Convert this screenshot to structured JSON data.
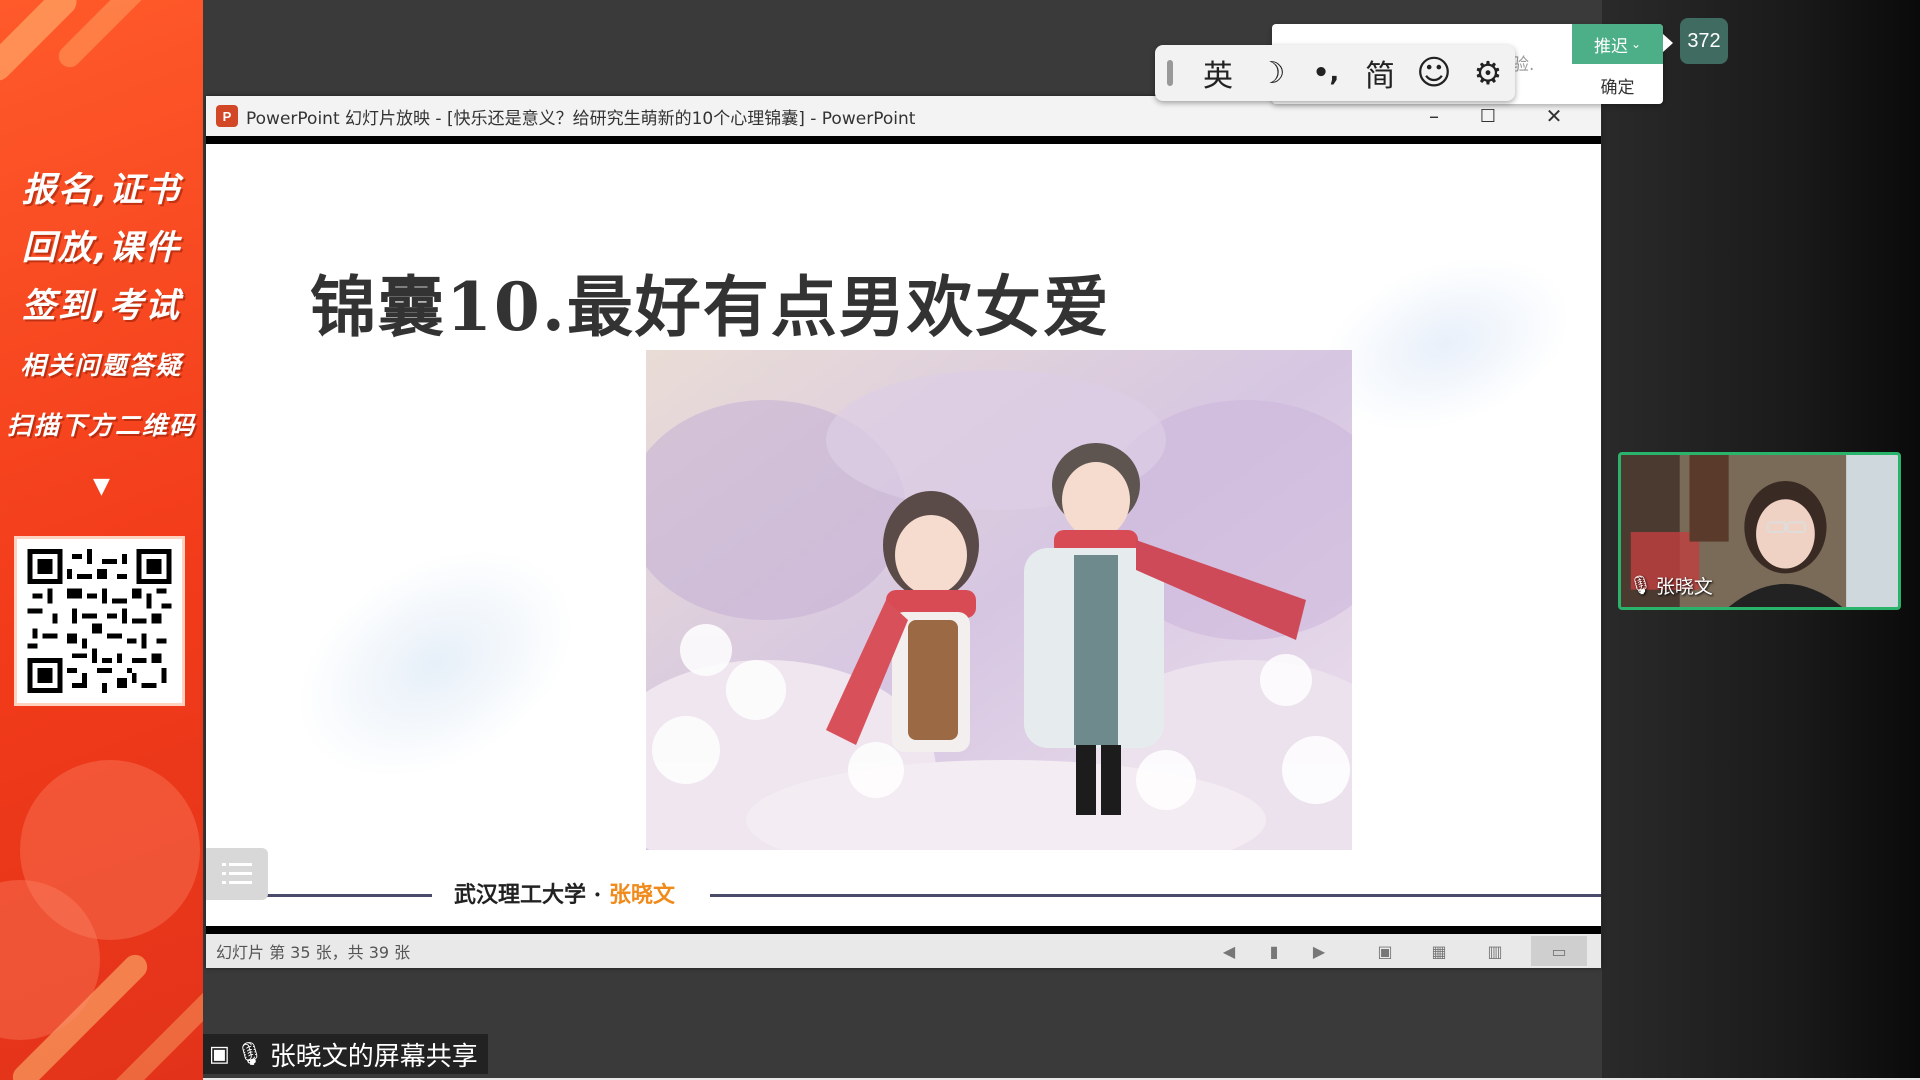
{
  "promo": {
    "lines": [
      "报名,证书",
      "回放,课件",
      "签到,考试",
      "相关问题答疑",
      "扫描下方二维码"
    ],
    "arrow": "▼"
  },
  "ppt": {
    "logo_letter": "P",
    "window_title": "PowerPoint 幻灯片放映 - [快乐还是意义？给研究生萌新的10个心理锦囊] - PowerPoint",
    "controls": {
      "minimize": "–",
      "maximize": "☐",
      "close": "✕"
    },
    "slide": {
      "title": "锦囊10.最好有点男欢女爱",
      "footer_school": "武汉理工大学 · ",
      "footer_name": "张晓文"
    },
    "status_text": "幻灯片 第 35 张，共 39 张"
  },
  "share_label": "张晓文的屏幕共享",
  "ime": {
    "lang": "英",
    "moon_icon": "☽",
    "punct": "•,",
    "script": "简",
    "emoji_icon": "☺",
    "settings_icon": "⚙"
  },
  "notification": {
    "text": "验.",
    "postpone": "推迟",
    "confirm": "确定"
  },
  "participant_count": "372",
  "video": {
    "name": "张晓文"
  }
}
